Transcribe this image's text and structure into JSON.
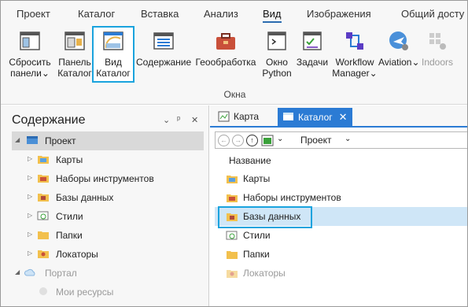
{
  "ribbon_tabs": [
    "Проект",
    "Каталог",
    "Вставка",
    "Анализ",
    "Вид",
    "Изображения",
    "Общий досту"
  ],
  "ribbon": {
    "buttons": [
      {
        "label1": "Сбросить",
        "label2": "панели",
        "dropdown": "⌄",
        "icon": "reset-panes-icon"
      },
      {
        "label1": "Панель",
        "label2": "Каталог",
        "icon": "catalog-pane-icon"
      },
      {
        "label1": "Вид",
        "label2": "Каталог",
        "icon": "catalog-view-icon"
      },
      {
        "label1": "Содержание",
        "label2": "",
        "icon": "contents-icon"
      },
      {
        "label1": "Геообработка",
        "label2": "",
        "icon": "geoprocessing-icon"
      },
      {
        "label1": "Окно",
        "label2": "Python",
        "icon": "python-window-icon"
      },
      {
        "label1": "Задачи",
        "label2": "",
        "icon": "tasks-icon"
      },
      {
        "label1": "Workflow",
        "label2": "Manager",
        "dropdown": "⌄",
        "icon": "workflow-manager-icon"
      },
      {
        "label1": "Aviation",
        "label2": "",
        "dropdown": "⌄",
        "icon": "aviation-icon"
      },
      {
        "label1": "Indoors",
        "label2": "",
        "icon": "indoors-icon"
      }
    ],
    "group_label": "Окна"
  },
  "contents_pane": {
    "title": "Содержание",
    "controls": [
      "⌄",
      "ᵖ",
      "✕"
    ],
    "tree": [
      {
        "label": "Проект",
        "expander": "◢",
        "icon": "project-icon"
      },
      {
        "label": "Карты",
        "expander": "▷",
        "icon": "maps-folder-icon"
      },
      {
        "label": "Наборы инструментов",
        "expander": "▷",
        "icon": "toolboxes-folder-icon"
      },
      {
        "label": "Базы данных",
        "expander": "▷",
        "icon": "databases-folder-icon"
      },
      {
        "label": "Стили",
        "expander": "▷",
        "icon": "styles-folder-icon"
      },
      {
        "label": "Папки",
        "expander": "▷",
        "icon": "folders-icon"
      },
      {
        "label": "Локаторы",
        "expander": "▷",
        "icon": "locators-folder-icon"
      },
      {
        "label": "Портал",
        "expander": "◢",
        "icon": "portal-icon"
      },
      {
        "label": "Мои ресурсы",
        "expander": "",
        "icon": "my-content-icon"
      }
    ]
  },
  "doc_tabs": [
    {
      "label": "Карта",
      "icon": "map-icon"
    },
    {
      "label": "Каталог",
      "icon": "catalog-icon",
      "close": "✕"
    }
  ],
  "catalog_view": {
    "address": "Проект",
    "address_dropdown": "⌄",
    "nav": [
      "←",
      "→",
      "↑"
    ],
    "column_header": "Название",
    "items": [
      {
        "label": "Карты",
        "icon": "maps-folder-icon"
      },
      {
        "label": "Наборы инструментов",
        "icon": "toolboxes-folder-icon"
      },
      {
        "label": "Базы данных",
        "icon": "databases-folder-icon"
      },
      {
        "label": "Стили",
        "icon": "styles-folder-icon"
      },
      {
        "label": "Папки",
        "icon": "folders-icon"
      },
      {
        "label": "Локаторы",
        "icon": "locators-folder-icon"
      }
    ]
  },
  "colors": {
    "accent": "#2b7bd4",
    "highlight": "#1aa3de",
    "selection": "#cfe6f7"
  }
}
